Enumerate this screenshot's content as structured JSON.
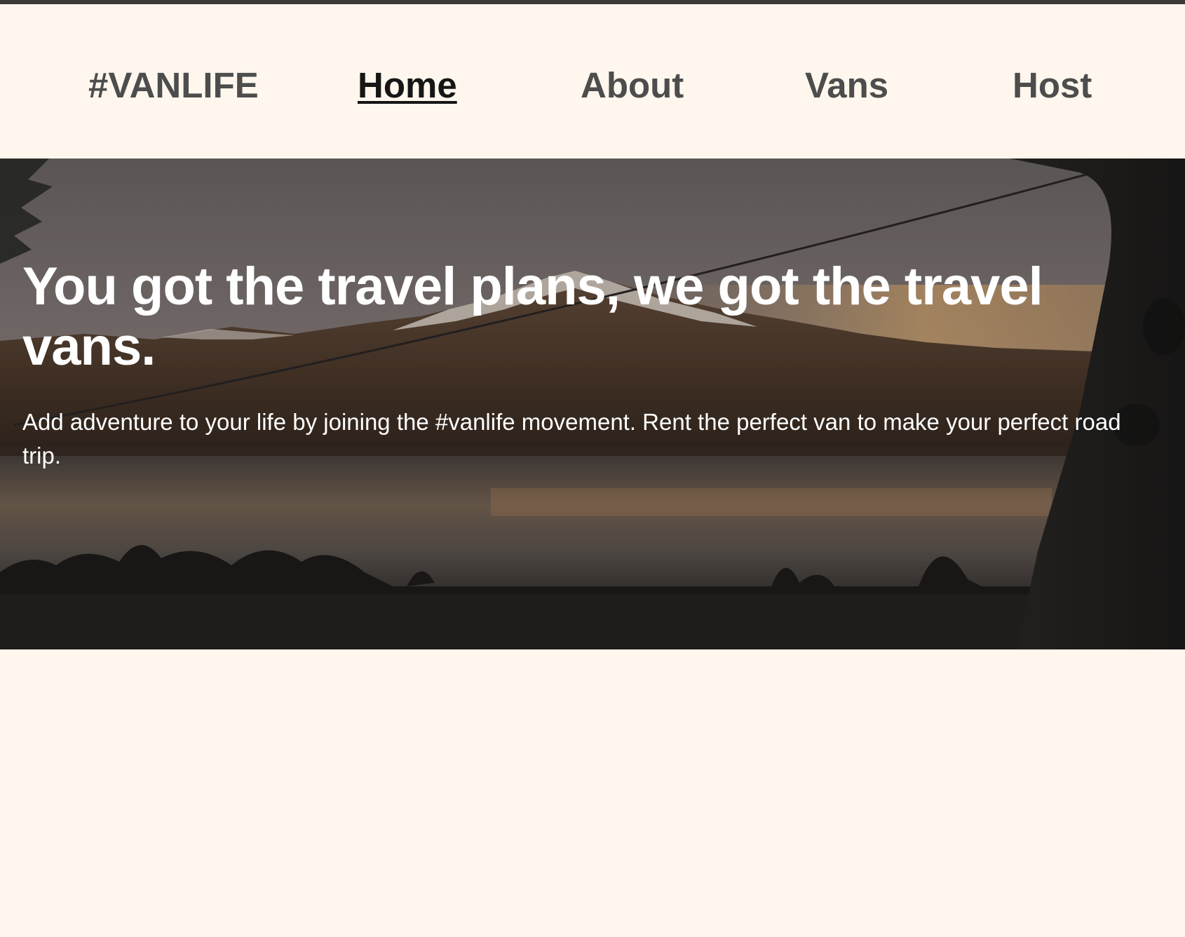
{
  "nav": {
    "brand": "#VANLIFE",
    "links": [
      {
        "label": "Home",
        "active": true
      },
      {
        "label": "About",
        "active": false
      },
      {
        "label": "Vans",
        "active": false
      },
      {
        "label": "Host",
        "active": false
      }
    ]
  },
  "hero": {
    "title": "You got the travel plans, we got the travel vans.",
    "subtitle": "Add adventure to your life by joining the #vanlife movement. Rent the perfect van to make your perfect road trip.",
    "image": "mountain-lake-view-from-van-photo"
  },
  "colors": {
    "page_background": "#FFF7ED",
    "nav_text": "#4D4D4D",
    "nav_active": "#161616",
    "hero_text": "#FFFFFF",
    "top_border": "#3B3A38"
  }
}
